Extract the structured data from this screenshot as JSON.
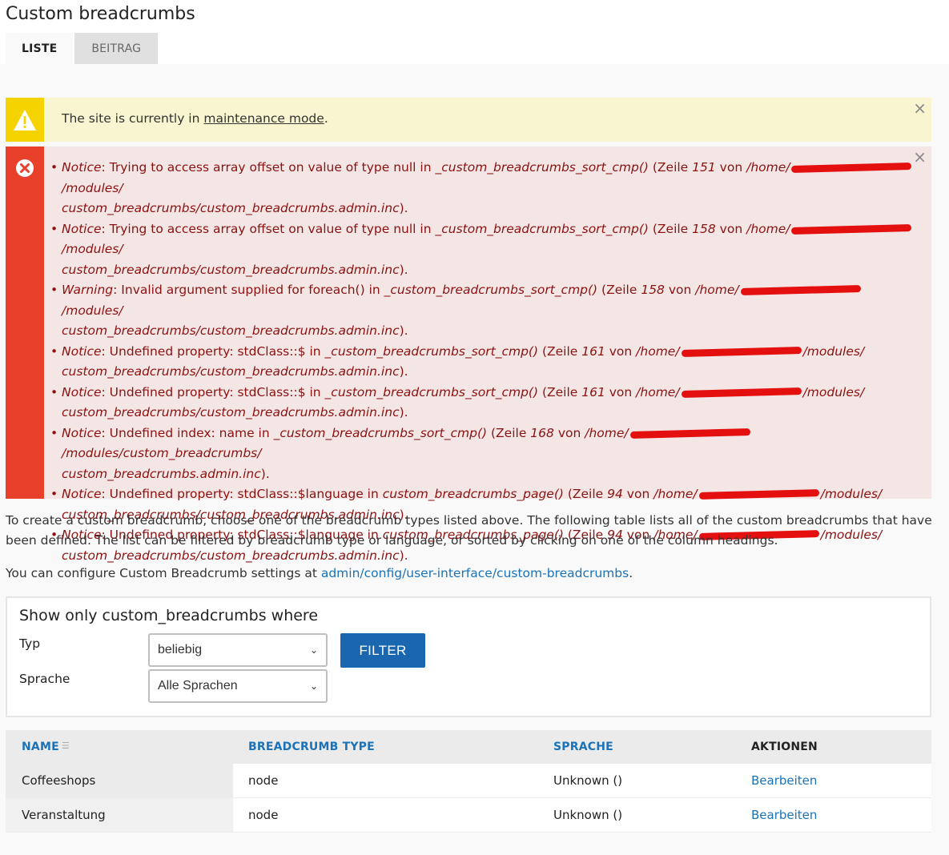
{
  "page": {
    "title": "Custom breadcrumbs"
  },
  "tabs": [
    {
      "label": "Liste",
      "active": true
    },
    {
      "label": "Beitrag",
      "active": false
    }
  ],
  "warning": {
    "prefix": "The site is currently in ",
    "link": "maintenance mode",
    "suffix": ".",
    "close": "×"
  },
  "errors": {
    "close": "×",
    "items": [
      {
        "type": "Notice",
        "msg": ": Trying to access array offset on value of type null in ",
        "func": "_custom_breadcrumbs_sort_cmp()",
        "zeile": " (Zeile ",
        "line": "151",
        "von": " von ",
        "path1": "/home/",
        "path2": "/modules/",
        "path3": "custom_breadcrumbs/custom_breadcrumbs.admin.inc",
        "end": ")."
      },
      {
        "type": "Notice",
        "msg": ": Trying to access array offset on value of type null in ",
        "func": "_custom_breadcrumbs_sort_cmp()",
        "zeile": " (Zeile ",
        "line": "158",
        "von": " von ",
        "path1": "/home/",
        "path2": "/modules/",
        "path3": "custom_breadcrumbs/custom_breadcrumbs.admin.inc",
        "end": ")."
      },
      {
        "type": "Warning",
        "msg": ": Invalid argument supplied for foreach() in ",
        "func": "_custom_breadcrumbs_sort_cmp()",
        "zeile": " (Zeile ",
        "line": "158",
        "von": " von ",
        "path1": "/home/",
        "path2": "/modules/",
        "path3": "custom_breadcrumbs/custom_breadcrumbs.admin.inc",
        "end": ")."
      },
      {
        "type": "Notice",
        "msg": ": Undefined property: stdClass::$ in ",
        "func": "_custom_breadcrumbs_sort_cmp()",
        "zeile": " (Zeile ",
        "line": "161",
        "von": " von ",
        "path1": "/home/",
        "path2": "/modules/",
        "path3": "custom_breadcrumbs/custom_breadcrumbs.admin.inc",
        "end": ")."
      },
      {
        "type": "Notice",
        "msg": ": Undefined property: stdClass::$ in ",
        "func": "_custom_breadcrumbs_sort_cmp()",
        "zeile": " (Zeile ",
        "line": "161",
        "von": " von ",
        "path1": "/home/",
        "path2": "/modules/",
        "path3": "custom_breadcrumbs/custom_breadcrumbs.admin.inc",
        "end": ")."
      },
      {
        "type": "Notice",
        "msg": ": Undefined index: name in ",
        "func": "_custom_breadcrumbs_sort_cmp()",
        "zeile": " (Zeile ",
        "line": "168",
        "von": " von ",
        "path1": "/home/",
        "path2": "/modules/custom_breadcrumbs/",
        "path3": "custom_breadcrumbs.admin.inc",
        "end": ")."
      },
      {
        "type": "Notice",
        "msg": ": Undefined property: stdClass::$language in ",
        "func": "custom_breadcrumbs_page()",
        "zeile": " (Zeile ",
        "line": "94",
        "von": " von ",
        "path1": "/home/",
        "path2": "/modules/",
        "path3": "custom_breadcrumbs/custom_breadcrumbs.admin.inc",
        "end": ")."
      },
      {
        "type": "Notice",
        "msg": ": Undefined property: stdClass::$language in ",
        "func": "custom_breadcrumbs_page()",
        "zeile": " (Zeile ",
        "line": "94",
        "von": " von ",
        "path1": "/home/",
        "path2": "/modules/",
        "path3": "custom_breadcrumbs/custom_breadcrumbs.admin.inc",
        "end": ")."
      }
    ]
  },
  "intro": "To create a custom breadcrumb, choose one of the breadcrumb types listed above. The following table lists all of the custom breadcrumbs that have been defined. The list can be filtered by breadcrumb type or language, or sorted by clicking on one of the column headings.",
  "config": {
    "prefix": "You can configure Custom Breadcrumb settings at ",
    "link": "admin/config/user-interface/custom-breadcrumbs",
    "suffix": "."
  },
  "filter": {
    "title": "Show only custom_breadcrumbs where",
    "typ_label": "Typ",
    "typ_value": "beliebig",
    "sprache_label": "Sprache",
    "sprache_value": "Alle Sprachen",
    "button": "Filter"
  },
  "table": {
    "headers": {
      "name": "Name",
      "type": "Breadcrumb type",
      "sprache": "Sprache",
      "aktionen": "Aktionen"
    },
    "rows": [
      {
        "name": "Coffeeshops",
        "type": "node",
        "sprache": "Unknown ()",
        "action": "Bearbeiten"
      },
      {
        "name": "Veranstaltung",
        "type": "node",
        "sprache": "Unknown ()",
        "action": "Bearbeiten"
      }
    ]
  },
  "colors": {
    "warning_bg": "#f8f5d0",
    "warning_icon": "#f4d300",
    "error_bg": "#f5e6e6",
    "error_icon": "#e8402a",
    "error_text": "#8b1111",
    "link": "#1a73b8",
    "button": "#1a67b0"
  }
}
